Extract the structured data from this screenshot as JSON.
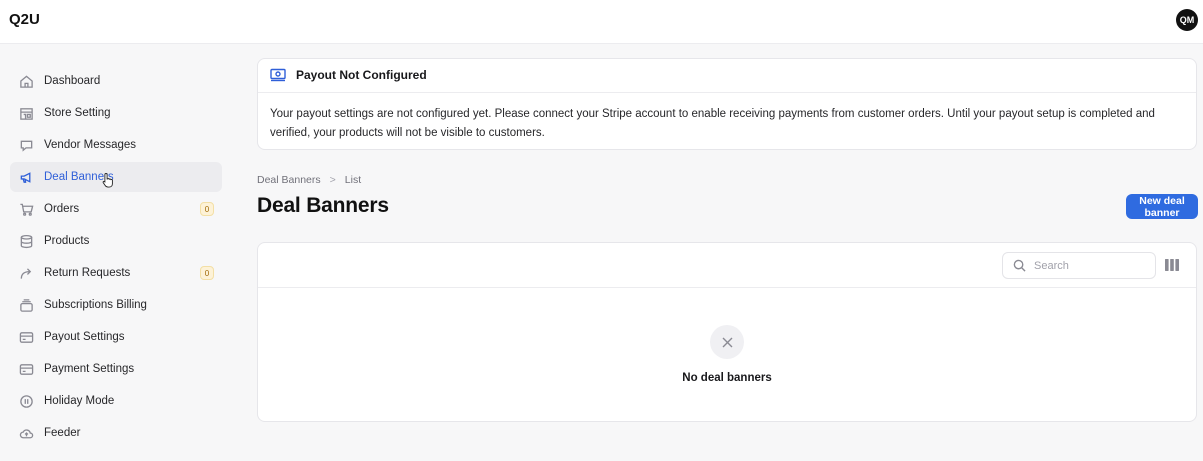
{
  "app": {
    "brand": "Q2U",
    "avatar_initials": "QM"
  },
  "sidebar": {
    "items": [
      {
        "label": "Dashboard",
        "icon": "home-icon"
      },
      {
        "label": "Store Setting",
        "icon": "store-icon"
      },
      {
        "label": "Vendor Messages",
        "icon": "chat-icon"
      },
      {
        "label": "Deal Banners",
        "icon": "megaphone-icon",
        "active": true
      },
      {
        "label": "Orders",
        "icon": "cart-icon",
        "badge": "0"
      },
      {
        "label": "Products",
        "icon": "database-icon"
      },
      {
        "label": "Return Requests",
        "icon": "return-arrow-icon",
        "badge": "0"
      },
      {
        "label": "Subscriptions Billing",
        "icon": "stack-icon"
      },
      {
        "label": "Payout Settings",
        "icon": "card-icon"
      },
      {
        "label": "Payment Settings",
        "icon": "card-icon"
      },
      {
        "label": "Holiday Mode",
        "icon": "pause-icon"
      },
      {
        "label": "Feeder",
        "icon": "cloud-upload-icon"
      }
    ]
  },
  "alert": {
    "title": "Payout Not Configured",
    "message": "Your payout settings are not configured yet. Please connect your Stripe account to enable receiving payments from customer orders. Until your payout setup is completed and verified, your products will not be visible to customers."
  },
  "breadcrumb": {
    "parent": "Deal Banners",
    "separator": ">",
    "current": "List"
  },
  "page": {
    "title": "Deal Banners",
    "new_button": "New deal banner"
  },
  "table": {
    "search_placeholder": "Search",
    "empty_text": "No deal banners"
  },
  "colors": {
    "accent": "#2f6be0",
    "active_nav": "#2f5fd8",
    "badge_bg": "#fdf2d7"
  }
}
